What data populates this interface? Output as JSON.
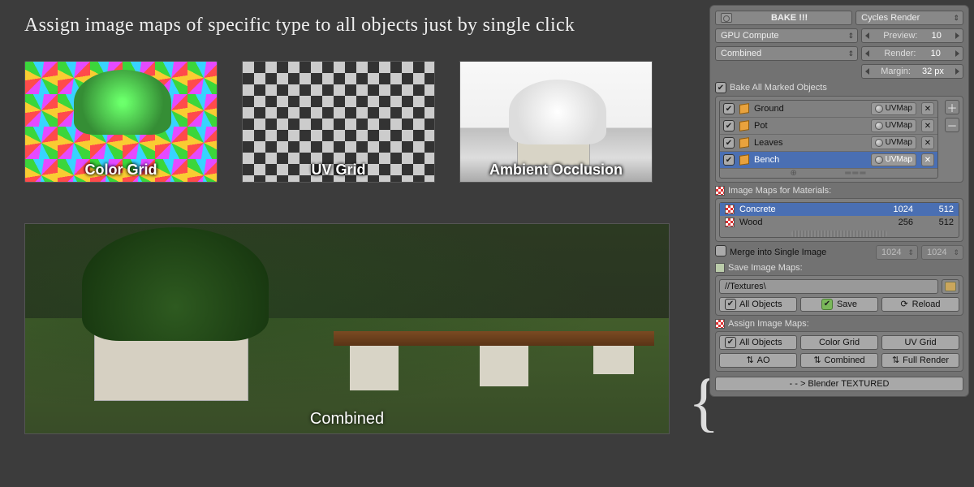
{
  "headline": "Assign image maps of specific type to all objects just by single click",
  "thumbs": [
    {
      "label": "Color Grid"
    },
    {
      "label": "UV Grid"
    },
    {
      "label": "Ambient Occlusion"
    }
  ],
  "big_preview_label": "Combined",
  "top": {
    "bake_button": "BAKE !!!",
    "render_engine": "Cycles Render",
    "device": "GPU Compute",
    "bake_type": "Combined",
    "preview_label": "Preview:",
    "preview_value": "10",
    "render_label": "Render:",
    "render_value": "10",
    "margin_label": "Margin:",
    "margin_value": "32 px"
  },
  "bake_all_label": "Bake All Marked Objects",
  "objects": [
    {
      "checked": true,
      "name": "Ground",
      "uv": "UVMap",
      "selected": false
    },
    {
      "checked": true,
      "name": "Pot",
      "uv": "UVMap",
      "selected": false
    },
    {
      "checked": true,
      "name": "Leaves",
      "uv": "UVMap",
      "selected": false
    },
    {
      "checked": true,
      "name": "Bench",
      "uv": "UVMap",
      "selected": true
    }
  ],
  "image_maps_header": "Image Maps for Materials:",
  "materials": [
    {
      "name": "Concrete",
      "w": "1024",
      "h": "512",
      "selected": true
    },
    {
      "name": "Wood",
      "w": "256",
      "h": "512",
      "selected": false
    }
  ],
  "merge": {
    "label": "Merge into Single Image",
    "w": "1024",
    "h": "1024"
  },
  "save_header": "Save Image Maps:",
  "path": "//Textures\\",
  "save": {
    "all_objects": "All Objects",
    "save": "Save",
    "reload": "Reload"
  },
  "assign_header": "Assign Image Maps:",
  "assign": {
    "all_objects": "All Objects",
    "color_grid": "Color Grid",
    "uv_grid": "UV Grid",
    "ao": "AO",
    "combined": "Combined",
    "full_render": "Full Render"
  },
  "footer": "- - > Blender TEXTURED"
}
